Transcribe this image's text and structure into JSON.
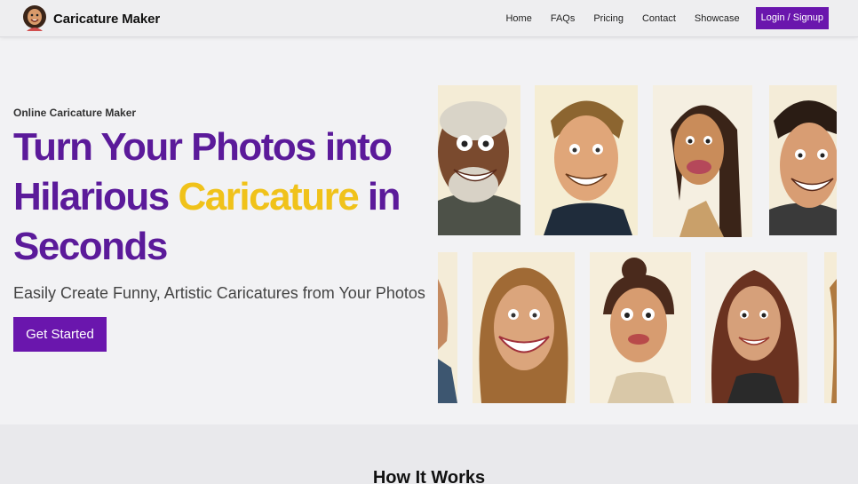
{
  "nav": {
    "brand": "Caricature Maker",
    "links": [
      "Home",
      "FAQs",
      "Pricing",
      "Contact",
      "Showcase"
    ],
    "login": "Login / Signup"
  },
  "hero": {
    "eyebrow": "Online Caricature Maker",
    "headline_line1": "Turn Your Photos into",
    "headline_line2a": "Hilarious ",
    "headline_highlight": "Caricature",
    "headline_line2b": " in",
    "headline_line3": "Seconds",
    "subheading": "Easily Create Funny, Artistic Caricatures from Your Photos",
    "cta": "Get Started"
  },
  "gallery": {
    "images": [
      "caricature-older-man-gray-beard",
      "caricature-man-blond-hair",
      "caricature-woman-long-dark-hair",
      "caricature-man-dark-hair",
      "caricature-partial-man",
      "caricature-woman-wavy-hair",
      "caricature-woman-hair-bun",
      "caricature-woman-auburn-hair",
      "caricature-partial-woman"
    ]
  },
  "section": {
    "title": "How It Works"
  },
  "colors": {
    "brand_purple": "#6a16ad",
    "headline_purple": "#5b1a9a",
    "highlight_yellow": "#f0c21a",
    "background": "#f2f2f4"
  }
}
